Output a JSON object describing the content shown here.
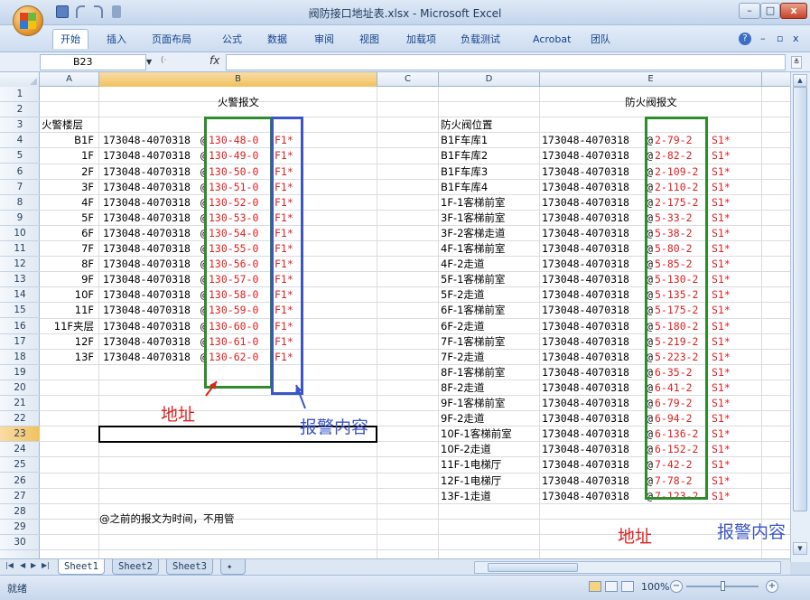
{
  "window": {
    "title": "阀防接口地址表.xlsx - Microsoft Excel",
    "controls": {
      "minimize": "–",
      "maximize": "□",
      "close": "x"
    }
  },
  "ribbon": {
    "tabs": [
      "开始",
      "插入",
      "页面布局",
      "公式",
      "数据",
      "审阅",
      "视图",
      "加载项",
      "负载测试",
      "Acrobat",
      "团队"
    ],
    "active_tab": "开始",
    "help_icon": "help-icon"
  },
  "formula_bar": {
    "name_box": "B23",
    "fx_label": "fx",
    "formula": ""
  },
  "columns": [
    "A",
    "B",
    "C",
    "D",
    "E"
  ],
  "selected_column": "B",
  "rows": [
    "1",
    "2",
    "3",
    "4",
    "5",
    "6",
    "7",
    "8",
    "9",
    "10",
    "11",
    "12",
    "13",
    "14",
    "15",
    "16",
    "17",
    "18",
    "19",
    "20",
    "21",
    "22",
    "23",
    "24",
    "25",
    "26",
    "27",
    "28",
    "29",
    "30"
  ],
  "selected_row": "23",
  "left_table": {
    "title": "火警报文",
    "header": "火警楼层",
    "rows": [
      {
        "floor": "B1F",
        "code": "173048-4070318",
        "addr": "130-48-0",
        "suffix": "F1*"
      },
      {
        "floor": "1F",
        "code": "173048-4070318",
        "addr": "130-49-0",
        "suffix": "F1*"
      },
      {
        "floor": "2F",
        "code": "173048-4070318",
        "addr": "130-50-0",
        "suffix": "F1*"
      },
      {
        "floor": "3F",
        "code": "173048-4070318",
        "addr": "130-51-0",
        "suffix": "F1*"
      },
      {
        "floor": "4F",
        "code": "173048-4070318",
        "addr": "130-52-0",
        "suffix": "F1*"
      },
      {
        "floor": "5F",
        "code": "173048-4070318",
        "addr": "130-53-0",
        "suffix": "F1*"
      },
      {
        "floor": "6F",
        "code": "173048-4070318",
        "addr": "130-54-0",
        "suffix": "F1*"
      },
      {
        "floor": "7F",
        "code": "173048-4070318",
        "addr": "130-55-0",
        "suffix": "F1*"
      },
      {
        "floor": "8F",
        "code": "173048-4070318",
        "addr": "130-56-0",
        "suffix": "F1*"
      },
      {
        "floor": "9F",
        "code": "173048-4070318",
        "addr": "130-57-0",
        "suffix": "F1*"
      },
      {
        "floor": "10F",
        "code": "173048-4070318",
        "addr": "130-58-0",
        "suffix": "F1*"
      },
      {
        "floor": "11F",
        "code": "173048-4070318",
        "addr": "130-59-0",
        "suffix": "F1*"
      },
      {
        "floor": "11F夹层",
        "code": "173048-4070318",
        "addr": "130-60-0",
        "suffix": "F1*"
      },
      {
        "floor": "12F",
        "code": "173048-4070318",
        "addr": "130-61-0",
        "suffix": "F1*"
      },
      {
        "floor": "13F",
        "code": "173048-4070318",
        "addr": "130-62-0",
        "suffix": "F1*"
      }
    ],
    "label_address": "地址",
    "label_alarm": "报警内容",
    "note": "@之前的报文为时间，不用管"
  },
  "right_table": {
    "title": "防火阀报文",
    "header": "防火阀位置",
    "rows": [
      {
        "loc": "B1F车库1",
        "code": "173048-4070318",
        "addr": "2-79-2",
        "suffix": "S1*"
      },
      {
        "loc": "B1F车库2",
        "code": "173048-4070318",
        "addr": "2-82-2",
        "suffix": "S1*"
      },
      {
        "loc": "B1F车库3",
        "code": "173048-4070318",
        "addr": "2-109-2",
        "suffix": "S1*"
      },
      {
        "loc": "B1F车库4",
        "code": "173048-4070318",
        "addr": "2-110-2",
        "suffix": "S1*"
      },
      {
        "loc": "1F-1客梯前室",
        "code": "173048-4070318",
        "addr": "2-175-2",
        "suffix": "S1*"
      },
      {
        "loc": "3F-1客梯前室",
        "code": "173048-4070318",
        "addr": "5-33-2",
        "suffix": "S1*"
      },
      {
        "loc": "3F-2客梯走道",
        "code": "173048-4070318",
        "addr": "5-38-2",
        "suffix": "S1*"
      },
      {
        "loc": "4F-1客梯前室",
        "code": "173048-4070318",
        "addr": "5-80-2",
        "suffix": "S1*"
      },
      {
        "loc": "4F-2走道",
        "code": "173048-4070318",
        "addr": "5-85-2",
        "suffix": "S1*"
      },
      {
        "loc": "5F-1客梯前室",
        "code": "173048-4070318",
        "addr": "5-130-2",
        "suffix": "S1*"
      },
      {
        "loc": "5F-2走道",
        "code": "173048-4070318",
        "addr": "5-135-2",
        "suffix": "S1*"
      },
      {
        "loc": "6F-1客梯前室",
        "code": "173048-4070318",
        "addr": "5-175-2",
        "suffix": "S1*"
      },
      {
        "loc": "6F-2走道",
        "code": "173048-4070318",
        "addr": "5-180-2",
        "suffix": "S1*"
      },
      {
        "loc": "7F-1客梯前室",
        "code": "173048-4070318",
        "addr": "5-219-2",
        "suffix": "S1*"
      },
      {
        "loc": "7F-2走道",
        "code": "173048-4070318",
        "addr": "5-223-2",
        "suffix": "S1*"
      },
      {
        "loc": "8F-1客梯前室",
        "code": "173048-4070318",
        "addr": "6-35-2",
        "suffix": "S1*"
      },
      {
        "loc": "8F-2走道",
        "code": "173048-4070318",
        "addr": "6-41-2",
        "suffix": "S1*"
      },
      {
        "loc": "9F-1客梯前室",
        "code": "173048-4070318",
        "addr": "6-79-2",
        "suffix": "S1*"
      },
      {
        "loc": "9F-2走道",
        "code": "173048-4070318",
        "addr": "6-94-2",
        "suffix": "S1*"
      },
      {
        "loc": "10F-1客梯前室",
        "code": "173048-4070318",
        "addr": "6-136-2",
        "suffix": "S1*"
      },
      {
        "loc": "10F-2走道",
        "code": "173048-4070318",
        "addr": "6-152-2",
        "suffix": "S1*"
      },
      {
        "loc": "11F-1电梯厅",
        "code": "173048-4070318",
        "addr": "7-42-2",
        "suffix": "S1*"
      },
      {
        "loc": "12F-1电梯厅",
        "code": "173048-4070318",
        "addr": "7-78-2",
        "suffix": "S1*"
      },
      {
        "loc": "13F-1走道",
        "code": "173048-4070318",
        "addr": "7-123-2",
        "suffix": "S1*"
      }
    ],
    "label_address": "地址",
    "label_alarm": "报警内容"
  },
  "sheet_tabs": [
    "Sheet1",
    "Sheet2",
    "Sheet3"
  ],
  "active_sheet": "Sheet1",
  "status": {
    "ready": "就绪",
    "zoom": "100%"
  },
  "colors": {
    "green_box": "#2e8b2e",
    "blue_box": "#3b55c8",
    "red_text": "#e02020",
    "blue_text": "#3b55c8"
  }
}
